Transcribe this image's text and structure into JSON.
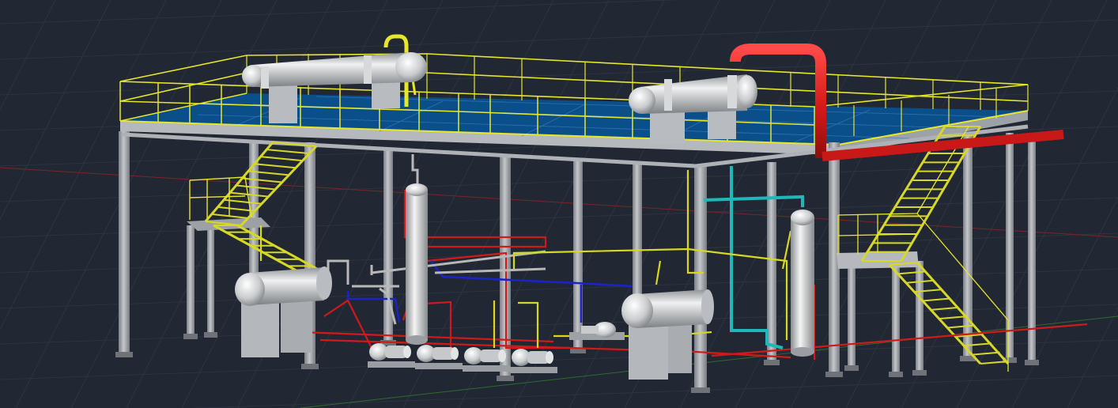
{
  "viewport": {
    "background": "#222833",
    "grid_color": "#2f3644",
    "x_axis_color": "#8a2a2a",
    "y_axis_color": "#2f6a2f"
  },
  "colors": {
    "steel_column": "#9a9ea3",
    "steel_column_shade": "#6d7278",
    "beam": "#b6babf",
    "deck": "#0b4f8a",
    "deck_grid": "#2a71b0",
    "handrail": "#e6e62a",
    "stair": "#d9d92a",
    "vessel": "#c8cacc",
    "vessel_highlight": "#f2f2f2",
    "saddle": "#b8bcc1",
    "pipe_red": "#d01a1a",
    "pipe_blue": "#1a23c8",
    "pipe_cyan": "#1fb8b8",
    "pipe_yellow": "#d8d820",
    "pipe_grey": "#b0b0b0",
    "pump": "#b9bcbf"
  },
  "equipment": [
    {
      "name": "top-exchanger-left"
    },
    {
      "name": "top-exchanger-right"
    },
    {
      "name": "column-vessel-center"
    },
    {
      "name": "column-vessel-right"
    },
    {
      "name": "drum-left"
    },
    {
      "name": "drum-center"
    },
    {
      "name": "pump-set"
    }
  ]
}
